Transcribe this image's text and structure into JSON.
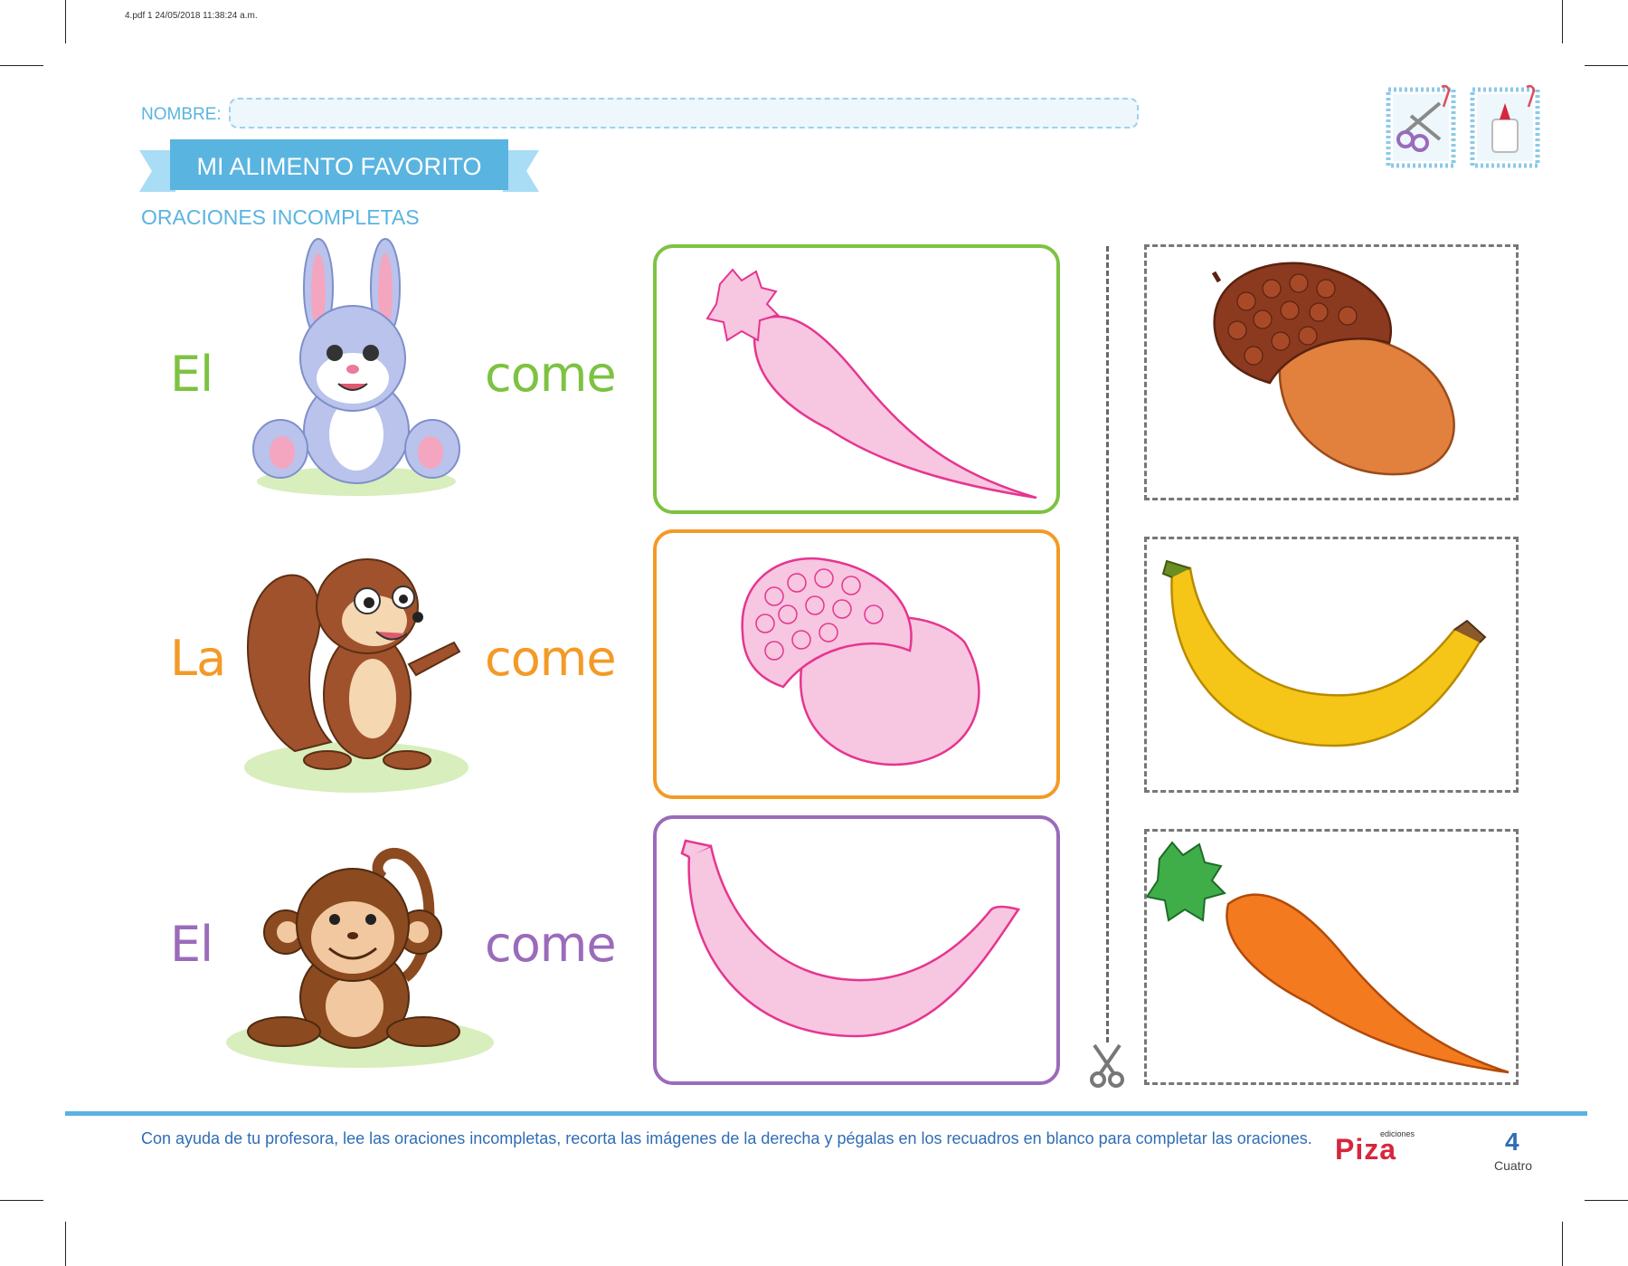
{
  "print_info": "4.pdf   1   24/05/2018   11:38:24 a.m.",
  "header": {
    "name_label": "NOMBRE:",
    "title": "MI ALIMENTO FAVORITO",
    "subtitle": "ORACIONES INCOMPLETAS"
  },
  "tool_icons": [
    "scissors-icon",
    "glue-icon"
  ],
  "rows": [
    {
      "article": "El",
      "animal": "rabbit",
      "verb": "come",
      "color": "#7dc242",
      "food_outline": "carrot"
    },
    {
      "article": "La",
      "animal": "squirrel",
      "verb": "come",
      "color": "#f39a27",
      "food_outline": "acorn"
    },
    {
      "article": "El",
      "animal": "monkey",
      "verb": "come",
      "color": "#9b6bbb",
      "food_outline": "banana"
    }
  ],
  "cutouts": [
    "acorn",
    "banana",
    "carrot"
  ],
  "footer": {
    "instructions": "Con ayuda de tu profesora, lee las oraciones incompletas, recorta las imágenes de la derecha y pégalas en los recuadros en blanco para completar las oraciones.",
    "brand_small": "ediciones",
    "brand": "Piza",
    "page_number": "4",
    "page_word": "Cuatro"
  },
  "colors": {
    "accent_blue": "#5ab4e0",
    "outline_pink": "#e6358f",
    "fill_pink": "#f7c6e1",
    "text_blue": "#2f6db5"
  }
}
